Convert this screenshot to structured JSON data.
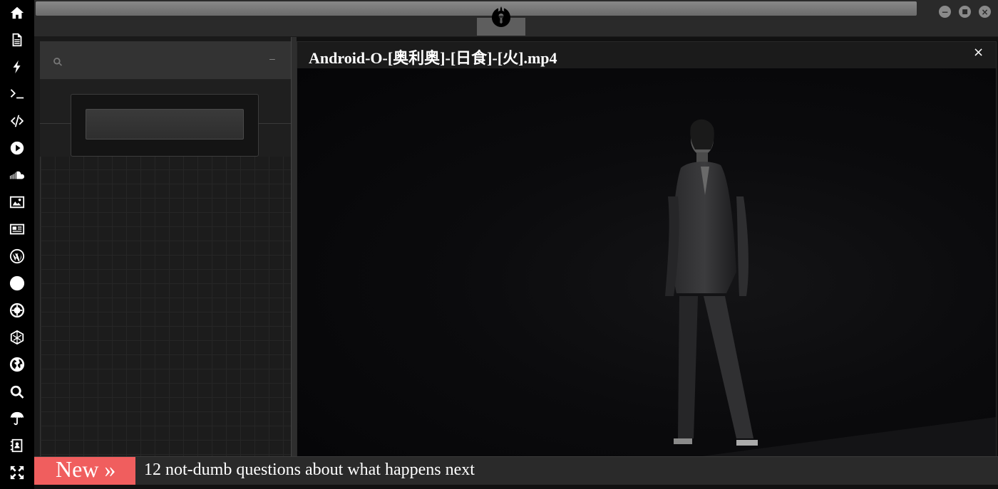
{
  "sidebar": {
    "icons": [
      {
        "name": "home-icon"
      },
      {
        "name": "document-icon"
      },
      {
        "name": "bolt-icon"
      },
      {
        "name": "terminal-icon"
      },
      {
        "name": "code-icon"
      },
      {
        "name": "play-circle-icon"
      },
      {
        "name": "soundcloud-icon"
      },
      {
        "name": "image-icon"
      },
      {
        "name": "newspaper-icon"
      },
      {
        "name": "wordpress-icon"
      },
      {
        "name": "pinterest-icon"
      },
      {
        "name": "galactic-empire-icon"
      },
      {
        "name": "hexagon-network-icon"
      },
      {
        "name": "globe-icon"
      },
      {
        "name": "search-icon"
      },
      {
        "name": "umbrella-icon"
      },
      {
        "name": "contact-card-icon"
      },
      {
        "name": "expand-arrows-icon"
      }
    ]
  },
  "topbar": {
    "logo": "rebel-alliance-logo",
    "window_buttons": {
      "minimize": "−",
      "maximize": "■",
      "close": "×"
    }
  },
  "left_panel": {
    "search_placeholder": "",
    "collapse_label": "–"
  },
  "video": {
    "title": "Android-O-[奥利奥]-[日食]-[火].mp4",
    "close_label": "×"
  },
  "ticker": {
    "badge": "New »",
    "headline": "12 not-dumb questions about what happens next"
  },
  "colors": {
    "sidebar_bg": "#000000",
    "panel_bg": "#2a2a2a",
    "ticker_badge": "#f05e5e",
    "video_bg": "#070709"
  }
}
